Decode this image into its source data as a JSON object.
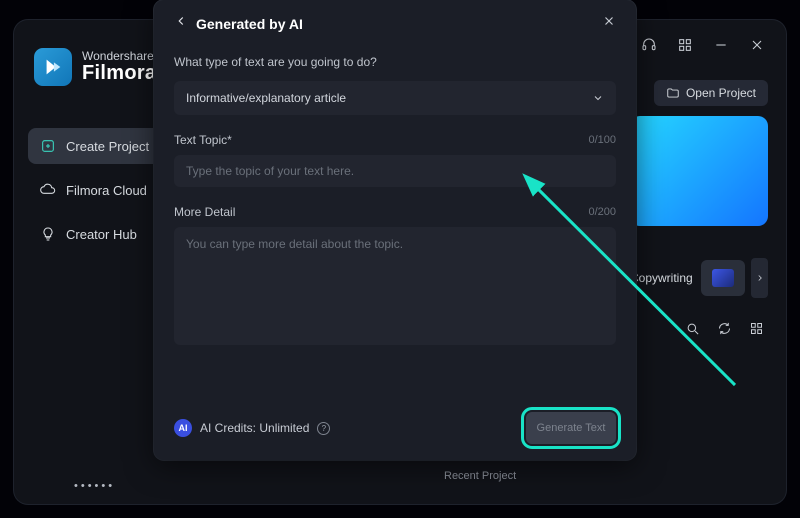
{
  "brand": {
    "line1": "Wondershare",
    "line2": "Filmora"
  },
  "titlebar": {
    "icons": [
      "cloud",
      "headset",
      "grid",
      "minimize",
      "close"
    ]
  },
  "sidebar": {
    "items": [
      {
        "label": "Create Project",
        "icon": "plus",
        "active": true
      },
      {
        "label": "Filmora Cloud",
        "icon": "cloud",
        "active": false
      },
      {
        "label": "Creator Hub",
        "icon": "bulb",
        "active": false
      }
    ]
  },
  "right": {
    "open_project": "Open Project",
    "carousel_label": "Copywriting",
    "recent_section": "Recent Project"
  },
  "modal": {
    "title": "Generated by AI",
    "question": "What type of text are you going to do?",
    "select_value": "Informative/explanatory article",
    "topic_label": "Text Topic*",
    "topic_count": "0/100",
    "topic_placeholder": "Type the topic of your text here.",
    "detail_label": "More Detail",
    "detail_count": "0/200",
    "detail_placeholder": "You can type more detail about the topic.",
    "credits_badge": "AI",
    "credits_text": "AI Credits: Unlimited",
    "generate_btn": "Generate Text"
  }
}
